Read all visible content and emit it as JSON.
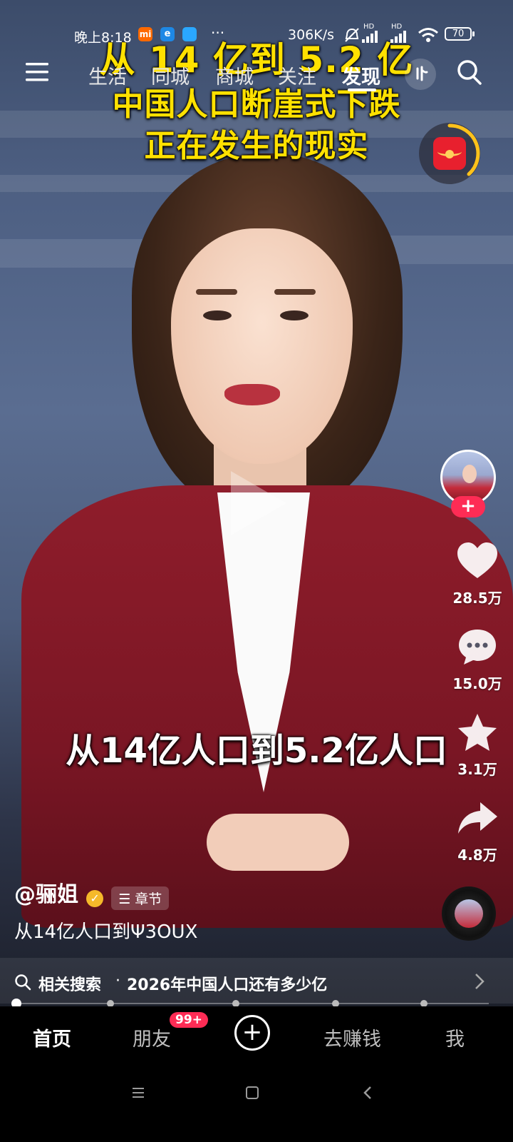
{
  "status_bar": {
    "time": "晚上8:18",
    "network_speed": "306K/s",
    "hd1": "HD",
    "hd2": "HD",
    "battery": "70"
  },
  "top_nav": {
    "tabs": [
      "生活",
      "同城",
      "商城",
      "关注",
      "发现"
    ],
    "active_tab": "发现"
  },
  "video": {
    "title_lines": [
      "从 14 亿到 5.2 亿",
      "中国人口断崖式下跌",
      "正在发生的现实"
    ],
    "subtitle": "从14亿人口到5.2亿人口",
    "caption_colors": {
      "title": "#ffe100",
      "subtitle": "#ffffff"
    }
  },
  "side_actions": {
    "likes": "28.5万",
    "comments": "15.0万",
    "favorites": "3.1万",
    "shares": "4.8万"
  },
  "author": {
    "name": "@骊姐",
    "chapter_label": "章节"
  },
  "description": "从14亿人口到Ψ3OUX",
  "related_search": {
    "label": "相关搜索",
    "separator": "·",
    "query": "2026年中国人口还有多少亿"
  },
  "bottom_tabs": {
    "home": "首页",
    "friends": "朋友",
    "friends_badge": "99+",
    "earn": "去赚钱",
    "me": "我"
  },
  "colors": {
    "accent_red": "#fe2c55",
    "gold": "#ffe100"
  }
}
